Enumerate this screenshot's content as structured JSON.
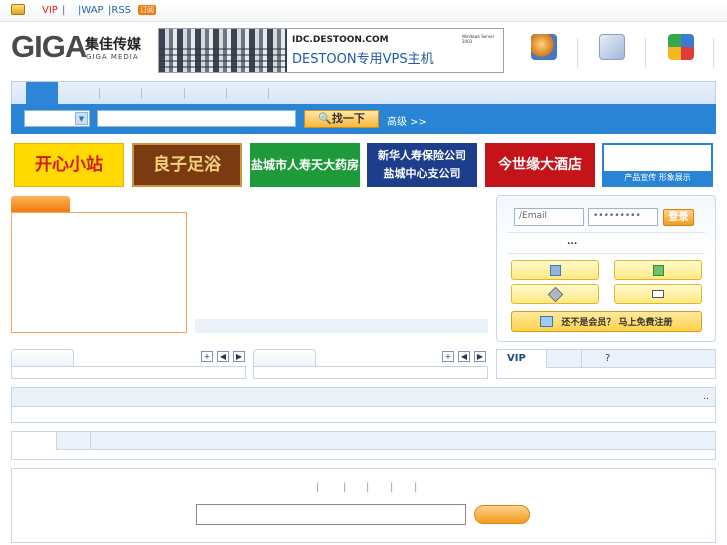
{
  "topbar": {
    "vip": "VIP",
    "sep1": "|",
    "wap": "|WAP",
    "rss": "|RSS",
    "rss_badge": "订阅"
  },
  "logo": {
    "giga": "GIGA",
    "cn": "集佳传媒",
    "en": "GIGA MEDIA"
  },
  "banner": {
    "domain": "IDC.DESTOON.COM",
    "title": "DESTOON专用VPS主机",
    "badge": "Windows Server 2003"
  },
  "search": {
    "button": "找一下",
    "advanced": "高级 >>"
  },
  "ads": [
    {
      "text": "开心小站",
      "bg": "#ffd900",
      "fg": "#d41a1a"
    },
    {
      "text": "良子足浴",
      "bg": "#7a3b12",
      "fg": "#f4d27a"
    },
    {
      "text": "盐城市人寿天大药房",
      "bg": "#1f9a3a",
      "fg": "#ffffff"
    },
    {
      "text": "新华人寿保险公司\n盐城中心支公司",
      "bg": "#1e3e8c",
      "fg": "#ffffff"
    },
    {
      "text": "今世缘大酒店",
      "bg": "#c4141a",
      "fg": "#ffffff"
    }
  ],
  "promo": {
    "text": "产品宣传 形象展示"
  },
  "login": {
    "email_placeholder": "/Email",
    "password_mask": "•••••••••",
    "login_button": "登录",
    "more": "...",
    "register_text": "还不是会员？ 马上免费注册"
  },
  "panels": {
    "ctl_add": "+",
    "ctl_prev": "◀",
    "ctl_next": "▶",
    "vip_tab": "VIP",
    "q_tab": "?",
    "more": ".."
  },
  "footer_seps": [
    "|",
    "|",
    "|",
    "|",
    "|"
  ],
  "colors": {
    "accent": "#2a84d6",
    "orange": "#f39a1f"
  }
}
